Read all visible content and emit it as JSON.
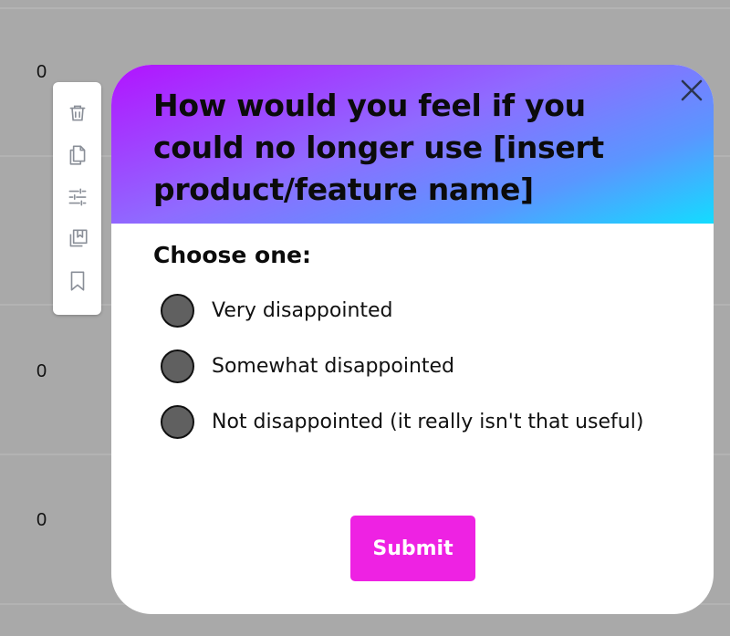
{
  "background": {
    "row_values": [
      "0",
      "0",
      "0"
    ]
  },
  "toolbar": {
    "icons": [
      "trash-icon",
      "copy-icon",
      "sliders-icon",
      "library-icon",
      "bookmark-icon"
    ]
  },
  "modal": {
    "title": "How would you feel if you could no longer use [insert product/feature name]",
    "choose_label": "Choose one:",
    "options": [
      {
        "label": "Very disappointed"
      },
      {
        "label": "Somewhat disappointed"
      },
      {
        "label": "Not disappointed (it really isn't that useful)"
      }
    ],
    "submit_label": "Submit"
  },
  "colors": {
    "accent": "#ee22e3",
    "gradient_start": "#b213ff",
    "gradient_end": "#13dcff",
    "radio_fill": "#606060"
  }
}
